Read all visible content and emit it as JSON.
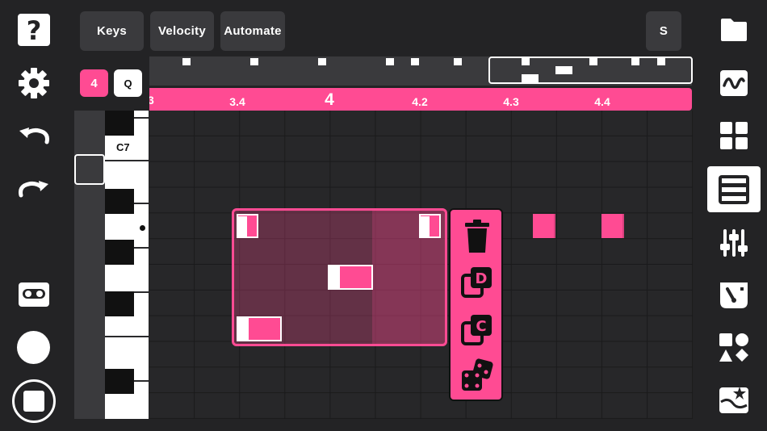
{
  "toolbar": {
    "tabs": [
      "Keys",
      "Velocity",
      "Automate"
    ],
    "s_label": "S"
  },
  "snap": {
    "grid_value": "4",
    "quantize_label": "Q"
  },
  "ruler": {
    "ticks": [
      "3",
      "3.4",
      "4",
      "4.2",
      "4.3",
      "4.4"
    ]
  },
  "keyboard": {
    "c7_label": "C7"
  },
  "left_sidebar": {
    "icons": [
      "help-icon",
      "settings-gear-icon",
      "undo-icon",
      "redo-icon",
      "cassette-tape-icon",
      "record-icon",
      "stop-icon"
    ]
  },
  "right_sidebar": {
    "icons": [
      "folder-icon",
      "waveform-icon",
      "grid-pads-icon",
      "piano-roll-icon",
      "mixer-sliders-icon",
      "tempo-meter-icon",
      "shapes-icon",
      "effects-icon"
    ]
  },
  "selection_menu": {
    "items": [
      "delete-icon",
      "duplicate-icon",
      "copy-icon",
      "randomize-dice-icon"
    ],
    "letters": [
      "D",
      "C"
    ]
  },
  "colors": {
    "accent": "#ff4b93",
    "background": "#232325",
    "button": "#3a3a3d"
  }
}
